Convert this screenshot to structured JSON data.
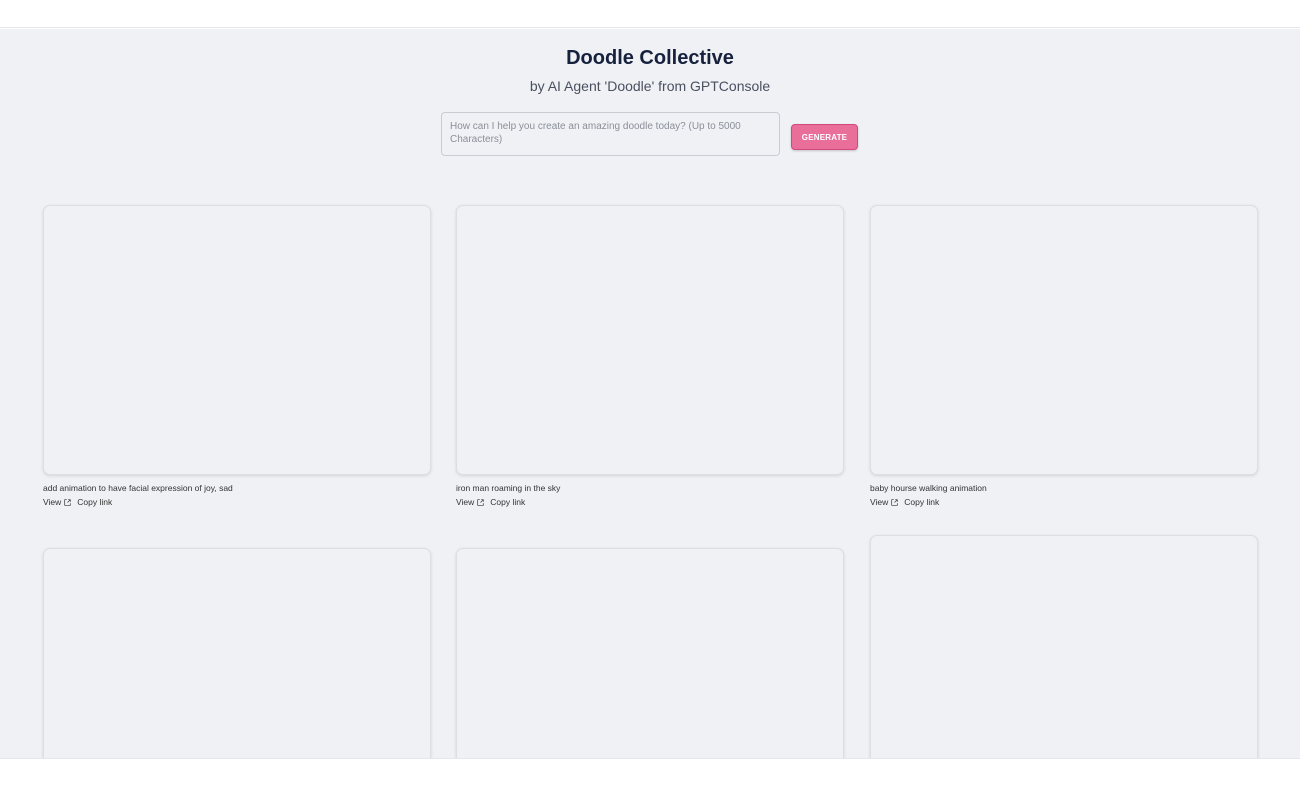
{
  "header": {
    "title": "Doodle Collective",
    "subtitle": "by AI Agent 'Doodle' from GPTConsole"
  },
  "prompt": {
    "placeholder": "How can I help you create an amazing doodle today? (Up to 5000 Characters)",
    "value": ""
  },
  "generate_button": {
    "label": "GENERATE",
    "color": "#ea6e9a"
  },
  "gallery": {
    "cards": [
      {
        "caption": "add animation to have facial expression of joy, sad",
        "view_label": "View",
        "copy_label": "Copy link",
        "view_icon": "external-link-icon"
      },
      {
        "caption": "iron man roaming in the sky",
        "view_label": "View",
        "copy_label": "Copy link",
        "view_icon": "external-link-icon"
      },
      {
        "caption": "baby hourse walking animation",
        "view_label": "View",
        "copy_label": "Copy link",
        "view_icon": "external-link-icon"
      },
      {
        "caption": ""
      },
      {
        "caption": ""
      },
      {
        "caption": ""
      }
    ]
  }
}
